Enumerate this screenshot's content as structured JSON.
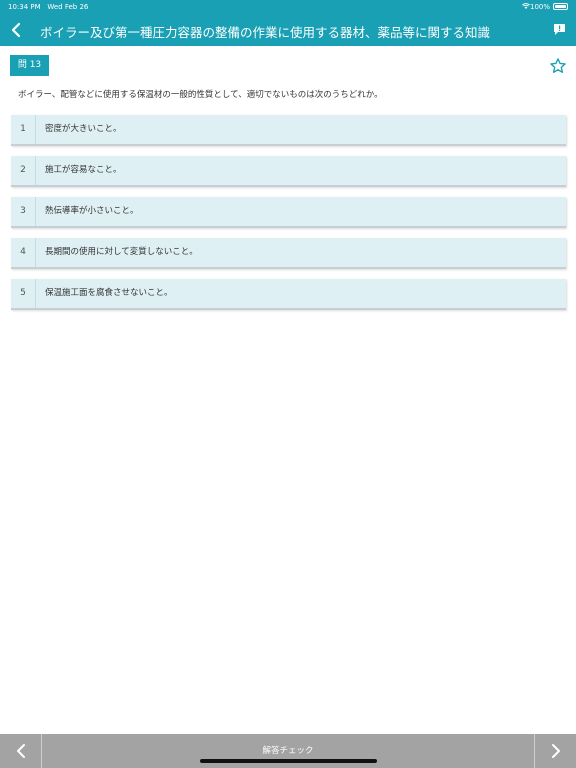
{
  "status_bar": {
    "time": "10:34 PM",
    "date": "Wed Feb 26",
    "battery": "100%",
    "icons": [
      "wifi-icon",
      "battery-icon"
    ]
  },
  "nav": {
    "back_icon": "chevron-left-icon",
    "title": "ボイラー及び第一種圧力容器の整備の作業に使用する器材、薬品等に関する知識",
    "comment_icon": "comment-icon"
  },
  "question": {
    "badge": "問 13",
    "favorite_icon": "star-outline-icon",
    "text": "ボイラー、配管などに使用する保温材の一般的性質として、適切でないものは次のうちどれか。"
  },
  "choices": [
    {
      "number": "1",
      "label": "密度が大きいこと。"
    },
    {
      "number": "2",
      "label": "施工が容易なこと。"
    },
    {
      "number": "3",
      "label": "熱伝導率が小さいこと。"
    },
    {
      "number": "4",
      "label": "長期間の使用に対して変質しないこと。"
    },
    {
      "number": "5",
      "label": "保温施工面を腐食させないこと。"
    }
  ],
  "toolbar": {
    "prev_icon": "chevron-left-icon",
    "answer_check": "解答チェック",
    "next_icon": "chevron-right-icon"
  },
  "colors": {
    "accent": "#19a0b4",
    "choice_bg": "#dff0f4",
    "toolbar_bg": "#a3a3a3"
  }
}
